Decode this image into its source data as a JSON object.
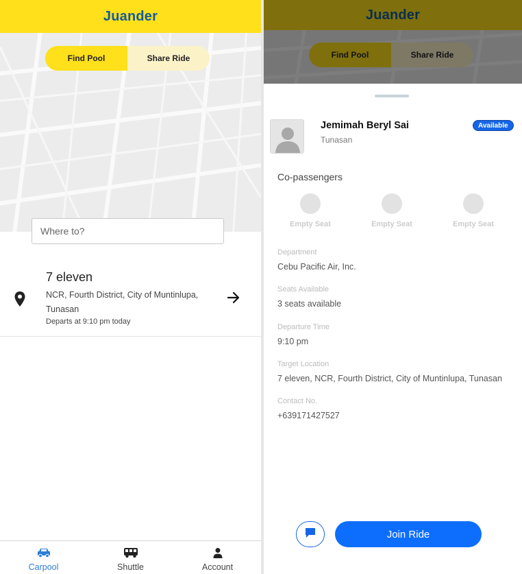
{
  "app": {
    "title": "Juander",
    "header_color": "#ffe01b",
    "header_dim_color": "#8a7a12"
  },
  "segments": {
    "find_pool": "Find Pool",
    "share_ride": "Share Ride",
    "active": "find_pool"
  },
  "search": {
    "placeholder": "Where to?"
  },
  "results": [
    {
      "title": "7 eleven",
      "address": "NCR, Fourth District, City of Muntinlupa, Tunasan",
      "departs": "Departs at 9:10 pm today",
      "icon": "location-pin-icon",
      "action_icon": "arrow-right-icon"
    }
  ],
  "nav": {
    "items": [
      {
        "label": "Carpool",
        "icon": "car-icon",
        "active": true
      },
      {
        "label": "Shuttle",
        "icon": "bus-icon",
        "active": false
      },
      {
        "label": "Account",
        "icon": "person-icon",
        "active": false
      }
    ],
    "active_color": "#2d7fd6"
  },
  "ride_detail": {
    "driver_name": "Jemimah Beryl Sai",
    "driver_location": "Tunasan",
    "status_badge": "Available",
    "co_passengers_label": "Co-passengers",
    "seats": [
      "Empty Seat",
      "Empty Seat",
      "Empty Seat"
    ],
    "fields": [
      {
        "label": "Department",
        "value": "Cebu Pacific Air, Inc."
      },
      {
        "label": "Seats Available",
        "value": "3 seats available"
      },
      {
        "label": "Departure Time",
        "value": "9:10 pm"
      },
      {
        "label": "Target Location",
        "value": "7 eleven, NCR, Fourth District, City of Muntinlupa, Tunasan"
      },
      {
        "label": "Contact No.",
        "value": "+639171427527"
      }
    ],
    "join_label": "Join Ride",
    "accent_color": "#0d6efd"
  }
}
